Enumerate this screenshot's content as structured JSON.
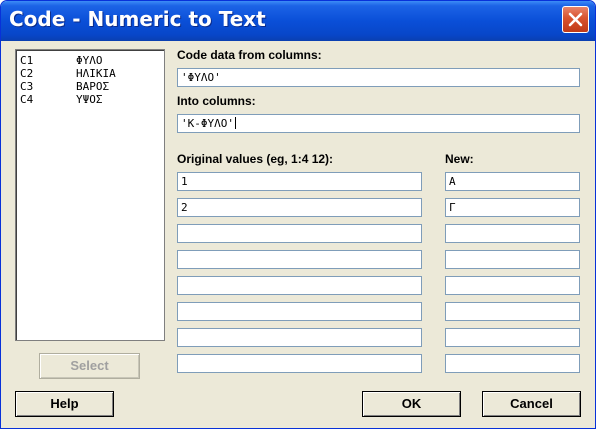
{
  "window": {
    "title": "Code - Numeric to Text"
  },
  "columns_list": [
    {
      "id": "C1",
      "name": "ΦΥΛΟ"
    },
    {
      "id": "C2",
      "name": "ΗΛΙΚΙΑ"
    },
    {
      "id": "C3",
      "name": "ΒΑΡΟΣ"
    },
    {
      "id": "C4",
      "name": "ΥΨΟΣ"
    }
  ],
  "form": {
    "code_from_label": "Code data from columns:",
    "code_from_value": "'ΦΥΛΟ'",
    "into_label": "Into columns:",
    "into_value": "'Κ-ΦΥΛΟ'",
    "original_label": "Original values (eg, 1:4 12):",
    "new_label": "New:",
    "rows": [
      {
        "original": "1",
        "new": "Α"
      },
      {
        "original": "2",
        "new": "Γ"
      },
      {
        "original": "",
        "new": ""
      },
      {
        "original": "",
        "new": ""
      },
      {
        "original": "",
        "new": ""
      },
      {
        "original": "",
        "new": ""
      },
      {
        "original": "",
        "new": ""
      },
      {
        "original": "",
        "new": ""
      }
    ]
  },
  "buttons": {
    "select": "Select",
    "help": "Help",
    "ok": "OK",
    "cancel": "Cancel"
  },
  "colors": {
    "titlebar": "#0a4fd8",
    "dialog_bg": "#ece9d8",
    "close_button": "#d8522e",
    "field_border": "#7f9db9"
  },
  "icons": {
    "close": "close-icon"
  }
}
